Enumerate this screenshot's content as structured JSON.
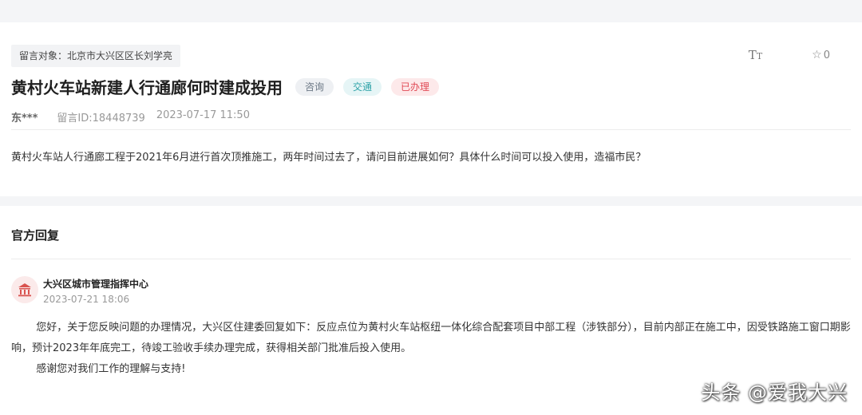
{
  "message": {
    "target_label": "留言对象：北京市大兴区区长刘学亮",
    "title": "黄村火车站新建人行通廊何时建成投用",
    "tags": [
      "咨询",
      "交通"
    ],
    "status": "已办理",
    "author": "东***",
    "message_id": "留言ID:18448739",
    "datetime": "2023-07-17 11:50",
    "content": "黄村火车站人行通廊工程于2021年6月进行首次顶推施工，两年时间过去了，请问目前进展如何？具体什么时间可以投入使用，造福市民？"
  },
  "tools": {
    "font_size_glyph": "T",
    "font_size_glyph_small": "T",
    "star_count": "0"
  },
  "reply": {
    "section_title": "官方回复",
    "department": "大兴区城市管理指挥中心",
    "datetime": "2023-07-21 18:06",
    "paragraph_1": "您好，关于您反映问题的办理情况，大兴区住建委回复如下：反应点位为黄村火车站枢纽一体化综合配套项目中部工程（涉铁部分），目前内部正在施工中，因受铁路施工窗口期影响，预计2023年年底完工，待竣工验收手续办理完成，获得相关部门批准后投入使用。",
    "paragraph_2": "感谢您对我们工作的理解与支持!"
  },
  "watermark": "头条 @爱我大兴",
  "colors": {
    "accent_teal": "#2fa3a8",
    "status_red": "#e04a55",
    "avatar_red": "#d9534f"
  }
}
